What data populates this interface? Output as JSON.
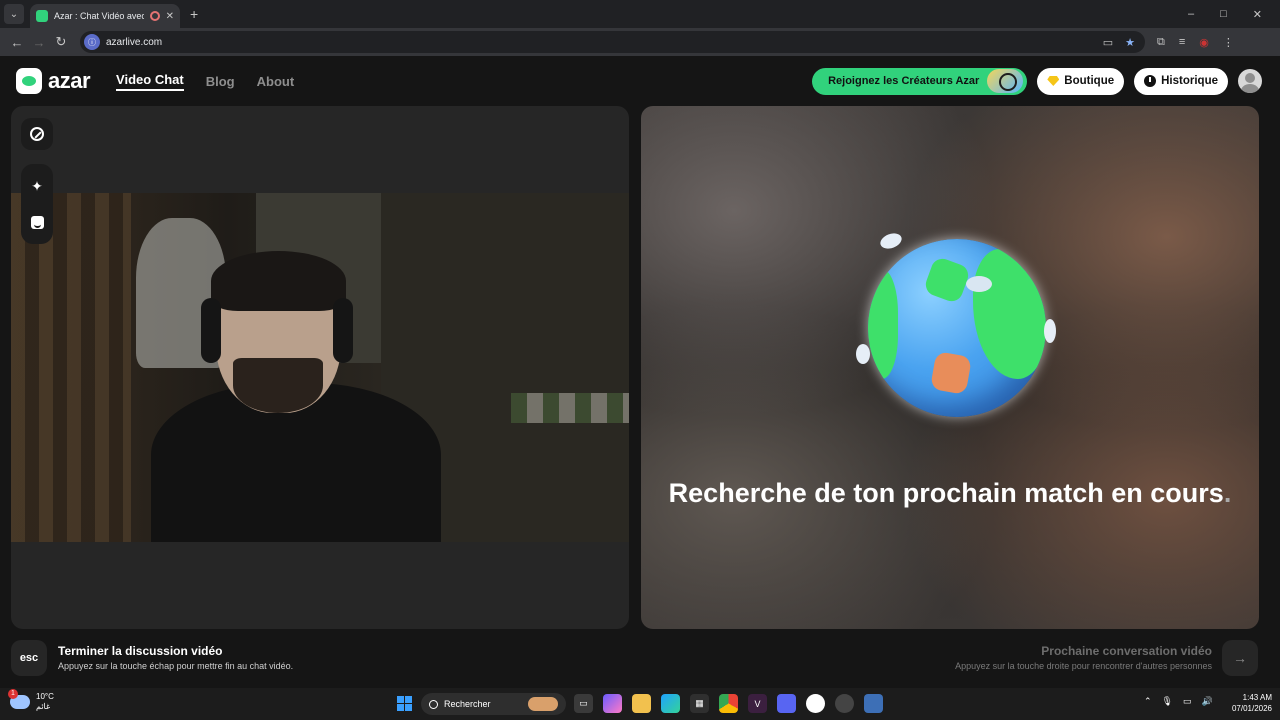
{
  "browser": {
    "tab_title": "Azar : Chat Vidéo avec de n",
    "url": "azarlive.com",
    "window_controls": [
      "–",
      "□",
      "✕"
    ]
  },
  "header": {
    "logo_text": "azar",
    "nav": [
      {
        "label": "Video Chat",
        "active": true
      },
      {
        "label": "Blog",
        "active": false
      },
      {
        "label": "About",
        "active": false
      }
    ],
    "creators_label": "Rejoignez les Créateurs Azar",
    "shop_label": "Boutique",
    "history_label": "Historique"
  },
  "left_tools": {
    "expand_icon": "expand-icon",
    "effects_icon": "sparkle-icon",
    "stickers_icon": "face-sticker-icon"
  },
  "match": {
    "status_text": "Recherche de ton prochain match en cours",
    "status_dot": "."
  },
  "footer": {
    "esc_key": "esc",
    "end_title": "Terminer la discussion vidéo",
    "end_desc": "Appuyez sur la touche échap pour mettre fin au chat vidéo.",
    "next_title": "Prochaine conversation vidéo",
    "next_desc": "Appuyez sur la touche droite pour rencontrer d'autres personnes",
    "next_arrow": "→"
  },
  "taskbar": {
    "temperature": "10°C",
    "weather_desc": "غائم",
    "search_label": "Rechercher",
    "time": "1:43 AM",
    "date": "07/01/2026"
  },
  "colors": {
    "brand_green": "#31d27c",
    "panel_bg": "#262626",
    "page_bg": "#151515"
  }
}
